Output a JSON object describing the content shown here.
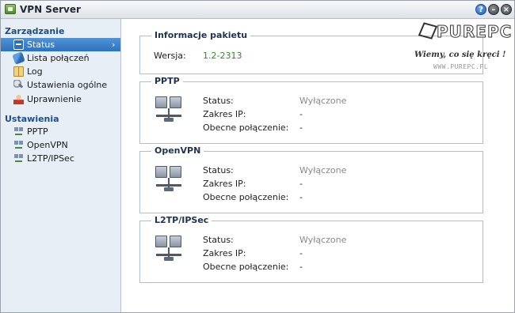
{
  "window": {
    "title": "VPN Server",
    "buttons": {
      "help": "?",
      "minimize": "",
      "close": ""
    }
  },
  "sidebar": {
    "sections": [
      {
        "heading": "Zarządzanie",
        "items": [
          {
            "label": "Status",
            "icon": "status-icon",
            "active": true
          },
          {
            "label": "Lista połączeń",
            "icon": "connection-list-icon"
          },
          {
            "label": "Log",
            "icon": "log-book-icon"
          },
          {
            "label": "Ustawienia ogólne",
            "icon": "settings-wrench-icon"
          },
          {
            "label": "Uprawnienie",
            "icon": "user-icon"
          }
        ]
      },
      {
        "heading": "Ustawienia",
        "items": [
          {
            "label": "PPTP",
            "icon": "network-icon"
          },
          {
            "label": "OpenVPN",
            "icon": "network-icon"
          },
          {
            "label": "L2TP/IPSec",
            "icon": "network-icon"
          }
        ]
      }
    ]
  },
  "main": {
    "package": {
      "title": "Informacje pakietu",
      "version_label": "Wersja:",
      "version_value": "1.2-2313"
    },
    "services": [
      {
        "title": "PPTP",
        "status_label": "Status:",
        "status_value": "Wyłączone",
        "ip_label": "Zakres IP:",
        "ip_value": "-",
        "conn_label": "Obecne połączenie:",
        "conn_value": "-"
      },
      {
        "title": "OpenVPN",
        "status_label": "Status:",
        "status_value": "Wyłączone",
        "ip_label": "Zakres IP:",
        "ip_value": "-",
        "conn_label": "Obecne połączenie:",
        "conn_value": "-"
      },
      {
        "title": "L2TP/IPSec",
        "status_label": "Status:",
        "status_value": "Wyłączone",
        "ip_label": "Zakres IP:",
        "ip_value": "-",
        "conn_label": "Obecne połączenie:",
        "conn_value": "-"
      }
    ]
  },
  "watermark": {
    "logo": "PUREPC",
    "tagline": "Wiemy, co się kręci !",
    "url": "WWW.PUREPC.PL"
  },
  "colors": {
    "accent": "#2f72bd",
    "section_heading": "#1d4e86",
    "version_green": "#2c8c1f",
    "disabled_grey": "#8a8a8a"
  }
}
